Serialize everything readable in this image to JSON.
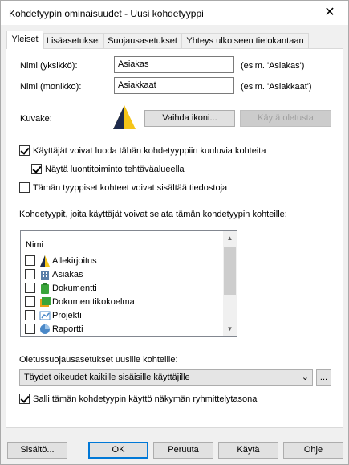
{
  "window": {
    "title": "Kohdetyypin ominaisuudet - Uusi kohdetyyppi",
    "close": "✕"
  },
  "tabs": [
    "Yleiset",
    "Lisäasetukset",
    "Suojausasetukset",
    "Yhteys ulkoiseen tietokantaan"
  ],
  "general": {
    "name_singular_label": "Nimi (yksikkö):",
    "name_singular_value": "Asiakas",
    "name_singular_hint": "(esim. 'Asiakas')",
    "name_plural_label": "Nimi (monikko):",
    "name_plural_value": "Asiakkaat",
    "name_plural_hint": "(esim. 'Asiakkaat')",
    "icon_label": "Kuvake:",
    "change_icon_button": "Vaihda ikoni...",
    "use_default_button": "Käytä oletusta",
    "cb_users_can_create": "Käyttäjät voivat luoda tähän kohdetyyppiin kuuluvia kohteita",
    "cb_show_create_command": "Näytä luontitoiminto tehtäväalueella",
    "cb_can_contain_files": "Tämän tyyppiset kohteet voivat sisältää tiedostoja",
    "browse_label": "Kohdetyypit, joita käyttäjät voivat selata tämän kohdetyypin kohteille:",
    "list_header": "Nimi",
    "list_items": [
      {
        "label": "Allekirjoitus",
        "icon": "signature-icon"
      },
      {
        "label": "Asiakas",
        "icon": "building-icon"
      },
      {
        "label": "Dokumentti",
        "icon": "document-icon"
      },
      {
        "label": "Dokumenttikokoelma",
        "icon": "document-collection-icon"
      },
      {
        "label": "Projekti",
        "icon": "project-icon"
      },
      {
        "label": "Raportti",
        "icon": "report-icon"
      }
    ],
    "security_label": "Oletussuojausasetukset uusille kohteille:",
    "security_value": "Täydet oikeudet kaikille sisäisille käyttäjille",
    "security_more_button": "...",
    "cb_allow_grouping": "Salli tämän kohdetyypin käyttö näkymän ryhmittelytasona"
  },
  "footer": {
    "contents_button": "Sisältö...",
    "ok_button": "OK",
    "cancel_button": "Peruuta",
    "apply_button": "Käytä",
    "help_button": "Ohje"
  },
  "colors": {
    "accent": "#0078d7",
    "icon_yellow": "#f5c518",
    "icon_dark": "#1e2b4d"
  }
}
